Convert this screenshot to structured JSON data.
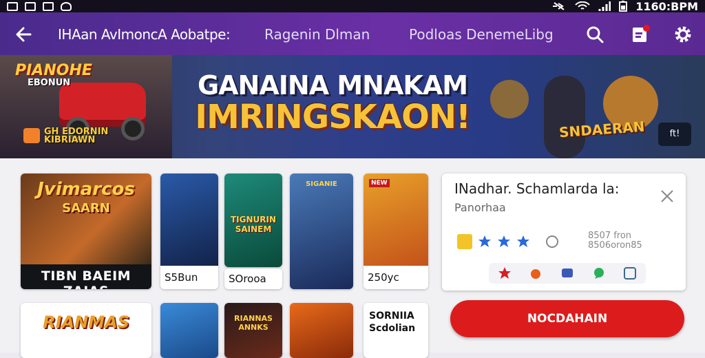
{
  "status": {
    "time": "1160:BPM"
  },
  "appbar": {
    "title": "IHAan AvImoncA Aobatpe:",
    "tab2": "Ragenin Dlman",
    "tab3": "Podloas DenemeLibg"
  },
  "banner": {
    "headline": "GANAINA MNAKAM",
    "subline": "IMRINGSKAON!",
    "logo_text": "PIANOHE",
    "logo_sub": "EBONUN",
    "badge_text_1": "GH EDORNIN",
    "badge_text_2": "KIBRIAWN",
    "right_label": "SNDAERAN",
    "corner_label": "ft!"
  },
  "games": [
    {
      "title": "Jvimarcos",
      "subtitle": "SAARN",
      "footer": "TIBN BAEIM ZAIAS"
    },
    {
      "caption": "S5Bun"
    },
    {
      "art_label": "TIGNURIN SAINEM"
    },
    {
      "art_label": "SIGANIE"
    },
    {
      "caption": "250yc",
      "badge": "NEW"
    },
    {
      "caption": "SOrooa"
    },
    {
      "art_label": "RIANMAS"
    },
    {
      "art_label": "RIANNAS ANNKS"
    },
    {
      "art_label": "SORNIIA Scdolian"
    }
  ],
  "card": {
    "title": "INadhar. Schamlarda la:",
    "subtitle": "Panorhaa",
    "rating_count": "8507 fron\n8506oron85",
    "accent": "#dc1c1c"
  },
  "primary_button": {
    "label": "NOCDAHAIN"
  }
}
